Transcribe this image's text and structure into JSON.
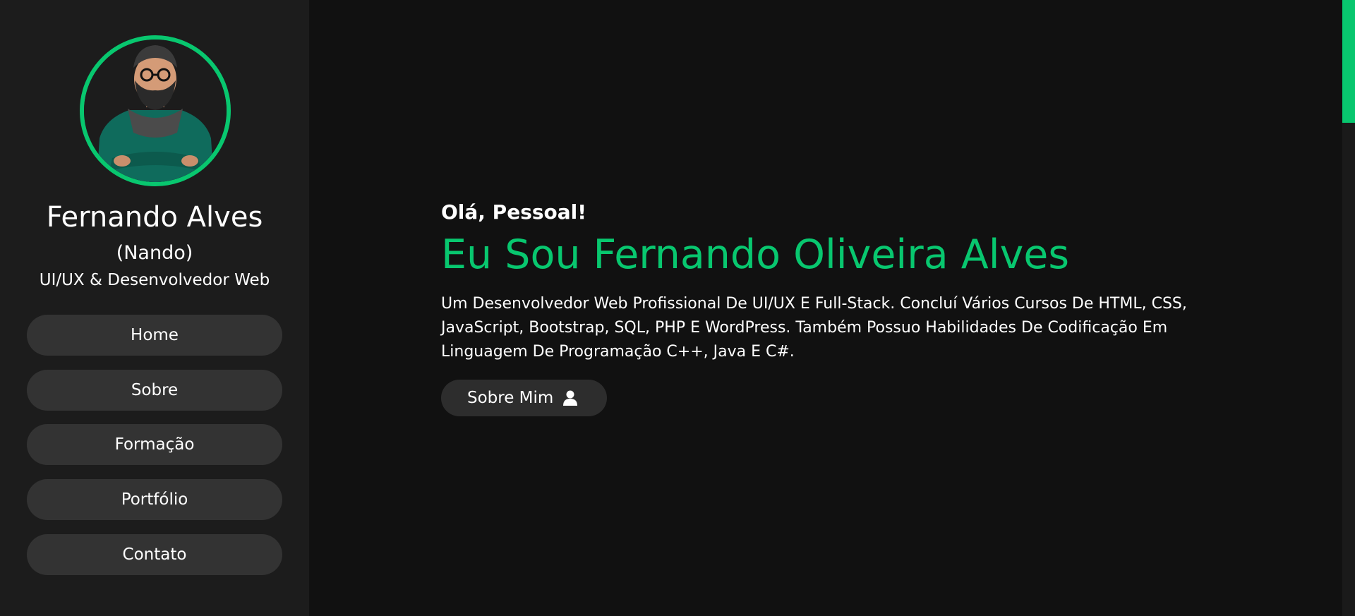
{
  "profile": {
    "name": "Fernando Alves",
    "nickname": "(Nando)",
    "role": "UI/UX & Desenvolvedor Web"
  },
  "nav": {
    "items": [
      {
        "label": "Home"
      },
      {
        "label": "Sobre"
      },
      {
        "label": "Formação"
      },
      {
        "label": "Portfólio"
      },
      {
        "label": "Contato"
      }
    ]
  },
  "hero": {
    "greeting": "Olá, Pessoal!",
    "headline": "Eu Sou Fernando Oliveira Alves",
    "description": "Um Desenvolvedor Web Profissional De UI/UX E Full-Stack. Concluí Vários Cursos De HTML, CSS, JavaScript, Bootstrap, SQL, PHP E WordPress. Também Possuo Habilidades De Codificação Em Linguagem De Programação C++, Java E C#.",
    "button_label": "Sobre Mim",
    "button_icon": "user-icon"
  },
  "colors": {
    "accent": "#08c76f",
    "sidebar_bg": "#1c1c1c",
    "main_bg": "#111111",
    "button_bg": "#333333"
  }
}
